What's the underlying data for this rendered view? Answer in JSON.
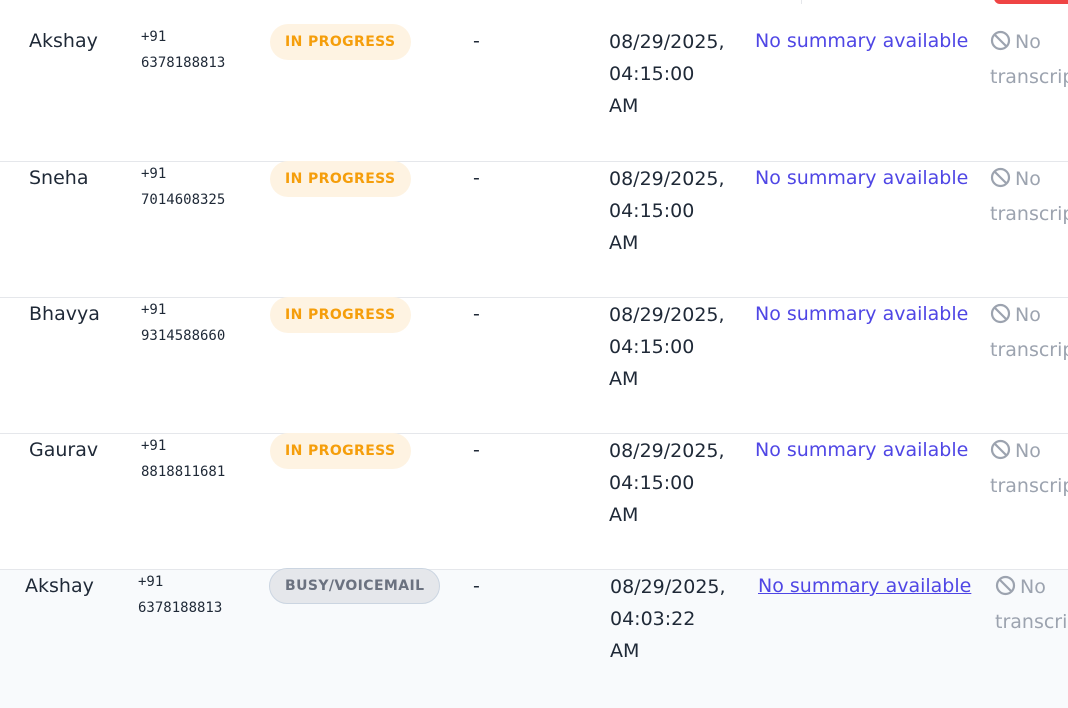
{
  "rows": [
    {
      "name": "Akshay",
      "phone": "+91\n6378188813",
      "status": "IN PROGRESS",
      "status_type": "in-progress",
      "duration": "-",
      "datetime": "08/29/2025,\n04:15:00\nAM",
      "summary": "No summary available",
      "transcript_line1": "No",
      "transcript_line2": "transcript"
    },
    {
      "name": "Sneha",
      "phone": "+91\n7014608325",
      "status": "IN PROGRESS",
      "status_type": "in-progress",
      "duration": "-",
      "datetime": "08/29/2025,\n04:15:00\nAM",
      "summary": "No summary available",
      "transcript_line1": "No",
      "transcript_line2": "transcript"
    },
    {
      "name": "Bhavya",
      "phone": "+91\n9314588660",
      "status": "IN PROGRESS",
      "status_type": "in-progress",
      "duration": "-",
      "datetime": "08/29/2025,\n04:15:00\nAM",
      "summary": "No summary available",
      "transcript_line1": "No",
      "transcript_line2": "transcript"
    },
    {
      "name": "Gaurav",
      "phone": "+91\n8818811681",
      "status": "IN PROGRESS",
      "status_type": "in-progress",
      "duration": "-",
      "datetime": "08/29/2025,\n04:15:00\nAM",
      "summary": "No summary available",
      "transcript_line1": "No",
      "transcript_line2": "transcript"
    },
    {
      "name": "Akshay",
      "phone": "+91\n6378188813",
      "status": "BUSY/VOICEMAIL",
      "status_type": "busy",
      "duration": "-",
      "datetime": "08/29/2025,\n04:03:22\nAM",
      "summary": "No summary available",
      "transcript_line1": "No",
      "transcript_line2": "transcript"
    }
  ],
  "colors": {
    "summary_link": "#4f46e5",
    "in_progress_text": "#f59e0b",
    "in_progress_bg": "#fef3e2",
    "busy_text": "#6b7280",
    "busy_bg": "#e5e7eb",
    "muted": "#9ca3af",
    "header_red": "#ef4444"
  },
  "icons": {
    "transcript": "ban-icon"
  }
}
